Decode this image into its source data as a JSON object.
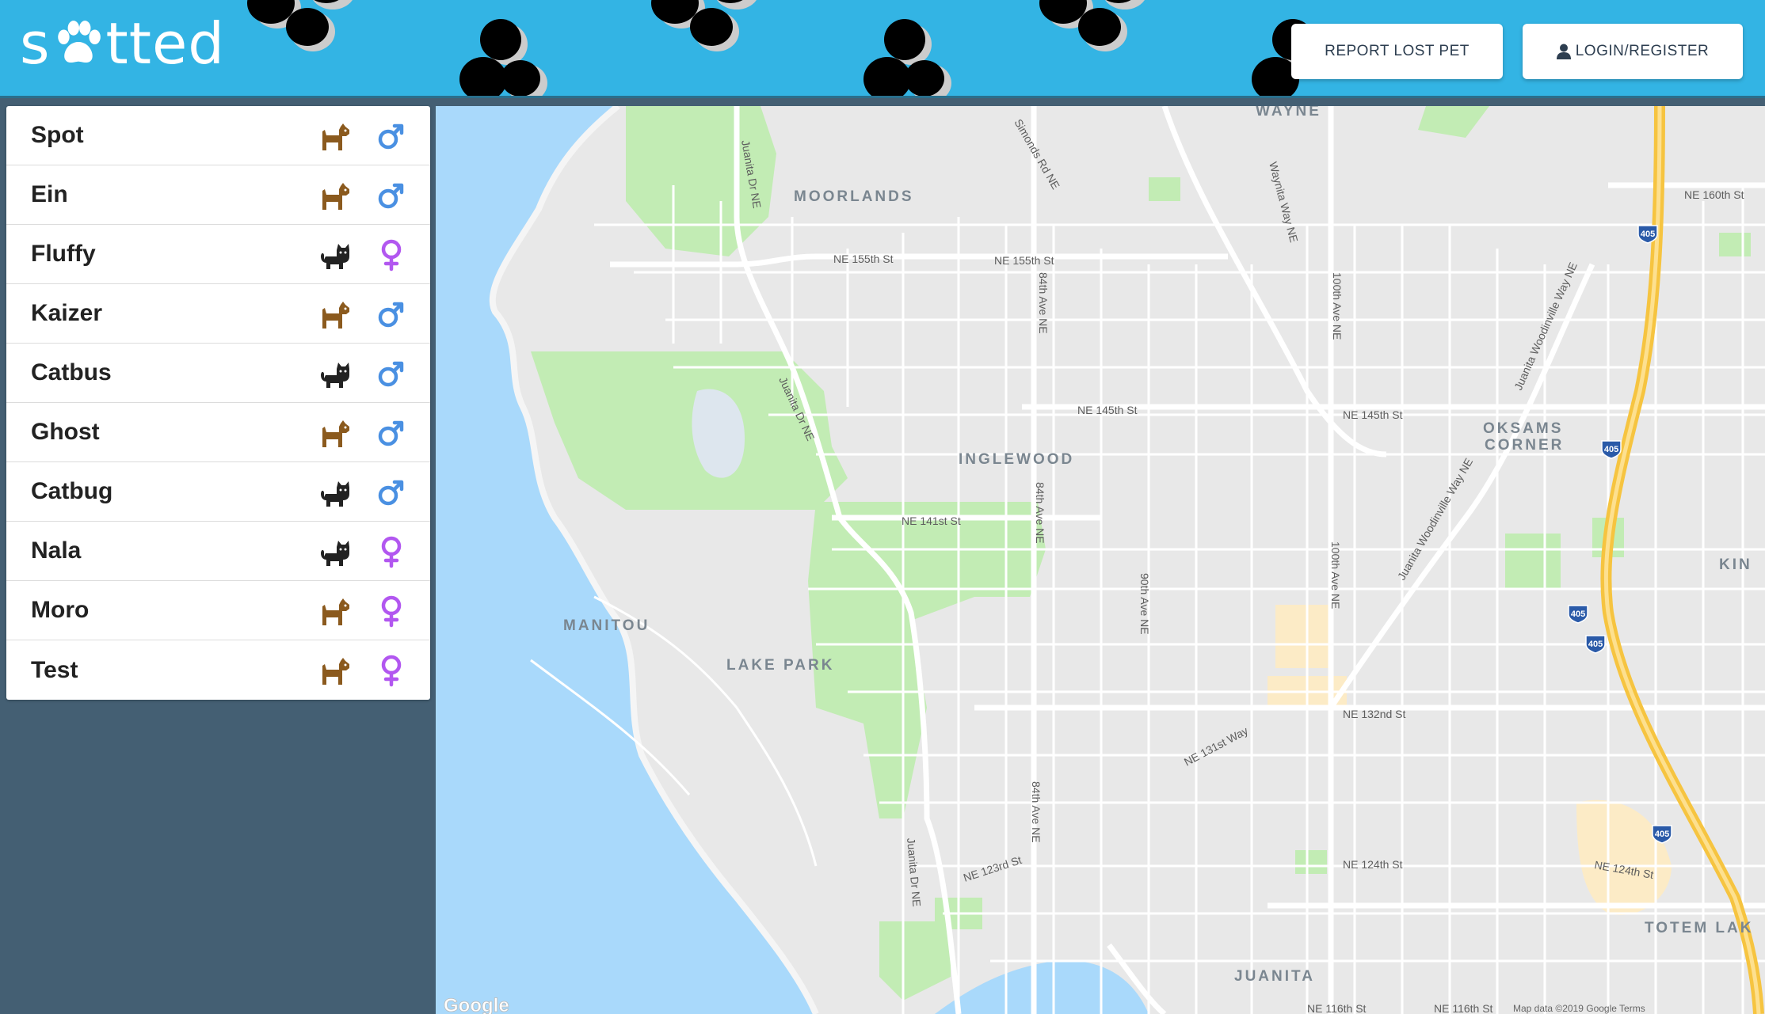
{
  "app": {
    "logo_text_before": "s",
    "logo_text_after": "tted",
    "logo_icon": "paw-icon"
  },
  "header": {
    "report_label": "REPORT LOST PET",
    "login_label": "LOGIN/REGISTER",
    "login_icon": "user-icon",
    "colors": {
      "background": "#33b4e4",
      "paw": "#000000"
    }
  },
  "pets": [
    {
      "name": "Spot",
      "species": "dog",
      "sex": "male"
    },
    {
      "name": "Ein",
      "species": "dog",
      "sex": "male"
    },
    {
      "name": "Fluffy",
      "species": "cat",
      "sex": "female"
    },
    {
      "name": "Kaizer",
      "species": "dog",
      "sex": "male"
    },
    {
      "name": "Catbus",
      "species": "cat",
      "sex": "male"
    },
    {
      "name": "Ghost",
      "species": "dog",
      "sex": "male"
    },
    {
      "name": "Catbug",
      "species": "cat",
      "sex": "male"
    },
    {
      "name": "Nala",
      "species": "cat",
      "sex": "female"
    },
    {
      "name": "Moro",
      "species": "dog",
      "sex": "female"
    },
    {
      "name": "Test",
      "species": "dog",
      "sex": "female"
    }
  ],
  "colors": {
    "male": "#4a90e2",
    "female": "#b257f0",
    "dog": "#8b5a1e",
    "cat": "#222222"
  },
  "map": {
    "neighborhoods": [
      "WAYNE",
      "MOORLANDS",
      "INGLEWOOD",
      "OKSAMS",
      "CORNER",
      "MANITOU",
      "LAKE PARK",
      "JUANITA",
      "TOTEM LAK",
      "KIN"
    ],
    "streets": [
      "NE 160th St",
      "NE 155th St",
      "NE 155th St",
      "NE 145th St",
      "NE 145th St",
      "NE 141st St",
      "NE 132nd St",
      "NE 131st Way",
      "NE 124th St",
      "NE 124th St",
      "NE 123rd St",
      "NE 116th St",
      "NE 116th St",
      "Juanita Dr NE",
      "Juanita Dr NE",
      "Juanita Dr NE",
      "Simonds Rd NE",
      "Waynita Way NE",
      "84th Ave NE",
      "84th Ave NE",
      "84th Ave NE",
      "90th Ave NE",
      "100th Ave NE",
      "100th Ave NE",
      "Juanita Woodinville Way NE",
      "Juanita Woodinville Way NE"
    ],
    "highway_shield": "405",
    "attribution": "Google",
    "footer": "Map data ©2019 Google Terms"
  }
}
